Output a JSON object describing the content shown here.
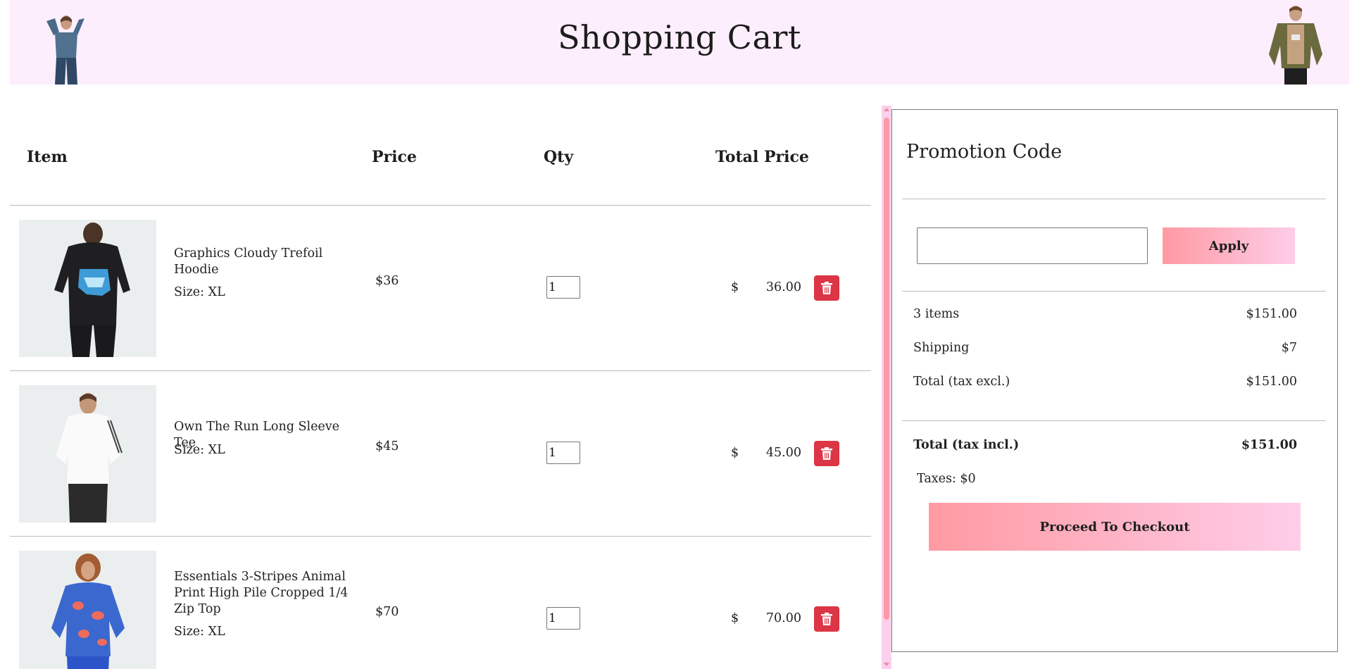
{
  "header": {
    "title": "Shopping Cart"
  },
  "cart": {
    "columns": {
      "item": "Item",
      "price": "Price",
      "qty": "Qty",
      "total": "Total Price"
    },
    "currency_symbol": "$",
    "items": [
      {
        "name": "Graphics Cloudy Trefoil Hoodie",
        "size": "Size: XL",
        "price": "$36",
        "qty": "1",
        "total": "36.00"
      },
      {
        "name": "Own The Run Long Sleeve Tee",
        "size": "Size: XL",
        "price": "$45",
        "qty": "1",
        "total": "45.00"
      },
      {
        "name": "Essentials 3-Stripes Animal Print High Pile Cropped 1/4 Zip Top",
        "size": "Size: XL",
        "price": "$70",
        "qty": "1",
        "total": "70.00"
      }
    ]
  },
  "promo": {
    "title": "Promotion Code",
    "input_value": "",
    "apply_label": "Apply"
  },
  "summary": {
    "items_label": "3 items",
    "items_value": "$151.00",
    "shipping_label": "Shipping",
    "shipping_value": "$7",
    "total_excl_label": "Total (tax excl.)",
    "total_excl_value": "$151.00",
    "total_incl_label": "Total (tax incl.)",
    "total_incl_value": "$151.00",
    "taxes": "Taxes: $0",
    "checkout_label": "Proceed To Checkout"
  },
  "colors": {
    "header_bg": "#fdeefd",
    "delete_button": "#dc3545",
    "gradient_start": "#ff9aa2",
    "gradient_end": "#fecde9"
  },
  "icons": {
    "delete": "trash-icon"
  }
}
